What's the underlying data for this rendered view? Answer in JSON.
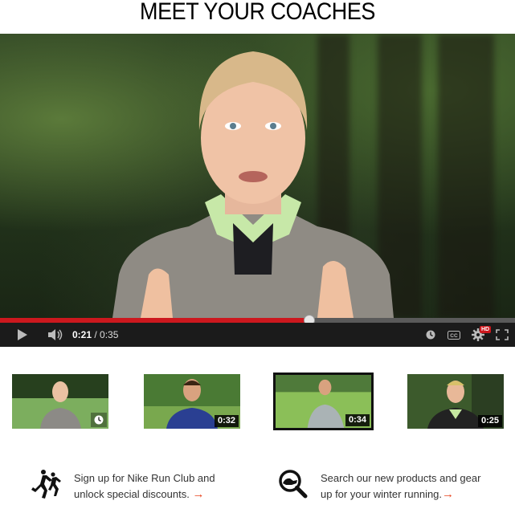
{
  "header": {
    "title": "MEET YOUR COACHES"
  },
  "player": {
    "progress": 0.6,
    "current_time": "0:21",
    "separator": " / ",
    "total_time": "0:35",
    "hd_badge": "HD",
    "icons": [
      "play-icon",
      "volume-icon",
      "watch-later-icon",
      "captions-icon",
      "settings-icon",
      "fullscreen-icon"
    ],
    "accent_color": "#cc181e"
  },
  "thumbnails": [
    {
      "label": "coach-1",
      "duration": "",
      "watch_later": true,
      "selected": false
    },
    {
      "label": "coach-2",
      "duration": "0:32",
      "selected": false
    },
    {
      "label": "coach-3",
      "duration": "0:34",
      "selected": true
    },
    {
      "label": "coach-4",
      "duration": "0:25",
      "selected": false
    }
  ],
  "promos": [
    {
      "icon": "runners-icon",
      "line1": "Sign up for Nike Run Club and",
      "line2": "unlock special discounts.",
      "arrow": "→"
    },
    {
      "icon": "search-products-icon",
      "line1": "Search our new products and gear",
      "line2": "up for your winter running.",
      "arrow": "→"
    }
  ],
  "colors": {
    "arrow": "#e8441e",
    "text": "#333333"
  }
}
